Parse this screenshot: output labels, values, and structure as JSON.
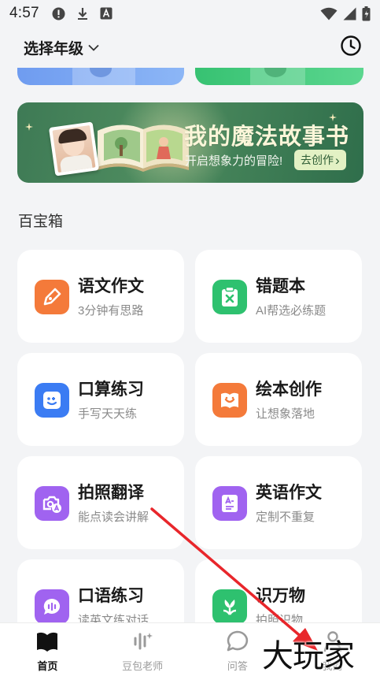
{
  "status_bar": {
    "time": "4:57"
  },
  "header": {
    "grade_label": "选择年级"
  },
  "banner": {
    "title": "我的魔法故事书",
    "subtitle": "开启想象力的冒险!",
    "button_label": "去创作",
    "button_arrow": "›"
  },
  "section": {
    "title": "百宝箱"
  },
  "tools": [
    {
      "title": "语文作文",
      "subtitle": "3分钟有思路",
      "icon": "pen-icon",
      "color": "#f47a3a"
    },
    {
      "title": "错题本",
      "subtitle": "AI帮选必练题",
      "icon": "clipboard-x-icon",
      "color": "#2ec16f"
    },
    {
      "title": "口算练习",
      "subtitle": "手写天天练",
      "icon": "smile-board-icon",
      "color": "#3b7cf3"
    },
    {
      "title": "绘本创作",
      "subtitle": "让想象落地",
      "icon": "picture-book-icon",
      "color": "#f47a3a"
    },
    {
      "title": "拍照翻译",
      "subtitle": "能点读会讲解",
      "icon": "camera-translate-icon",
      "color": "#a063f0"
    },
    {
      "title": "英语作文",
      "subtitle": "定制不重复",
      "icon": "english-doc-icon",
      "color": "#a063f0"
    },
    {
      "title": "口语练习",
      "subtitle": "读英文练对话",
      "icon": "speech-bubble-icon",
      "color": "#a063f0"
    },
    {
      "title": "识万物",
      "subtitle": "拍照识物",
      "icon": "flower-icon",
      "color": "#2ec16f"
    }
  ],
  "nav": [
    {
      "label": "首页",
      "icon": "book-icon",
      "active": true
    },
    {
      "label": "豆包老师",
      "icon": "voice-bars-icon",
      "active": false
    },
    {
      "label": "问答",
      "icon": "chat-bubble-icon",
      "active": false
    },
    {
      "label": "我的",
      "icon": "profile-icon",
      "active": false
    }
  ],
  "watermark": "大玩家"
}
